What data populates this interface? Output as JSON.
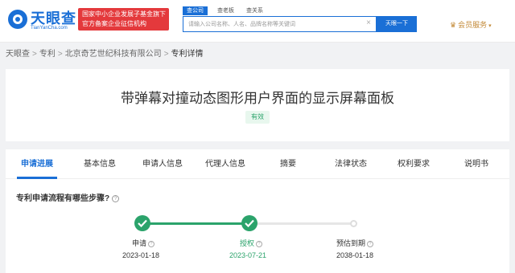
{
  "header": {
    "logo_cn": "天眼查",
    "logo_en": "TianYanCha.com",
    "badge_line1": "国家中小企业发展子基金旗下",
    "badge_line2": "官方备案企业征信机构",
    "search_tabs": [
      "查公司",
      "查老板",
      "查关系"
    ],
    "search_placeholder": "请输入公司名称、人名、品牌名称等关键词",
    "clear_glyph": "×",
    "search_button": "天眼一下",
    "member": "会员服务"
  },
  "breadcrumb": [
    "天眼查",
    "专利",
    "北京奇艺世纪科技有限公司",
    "专利详情"
  ],
  "patent": {
    "title": "带弹幕对撞动态图形用户界面的显示屏幕面板",
    "status": "有效"
  },
  "tabs": [
    "申请进展",
    "基本信息",
    "申请人信息",
    "代理人信息",
    "摘要",
    "法律状态",
    "权利要求",
    "说明书"
  ],
  "progress": {
    "question": "专利申请流程有哪些步骤?",
    "help_glyph": "?",
    "steps": [
      {
        "label": "申请",
        "date": "2023-01-18",
        "done": true
      },
      {
        "label": "授权",
        "date": "2023-07-21",
        "done": true
      },
      {
        "label": "预估到期",
        "date": "2038-01-18",
        "done": false
      }
    ]
  },
  "colors": {
    "brand_blue": "#1a6fd6",
    "badge_red": "#e4393c",
    "status_green": "#2ba36b",
    "member_gold": "#c38a38"
  },
  "icons": {
    "logo": "tianyancha-eye-logo",
    "clear": "close-icon",
    "member": "crown-icon",
    "help": "question-circle-icon",
    "step_done": "check-icon"
  }
}
